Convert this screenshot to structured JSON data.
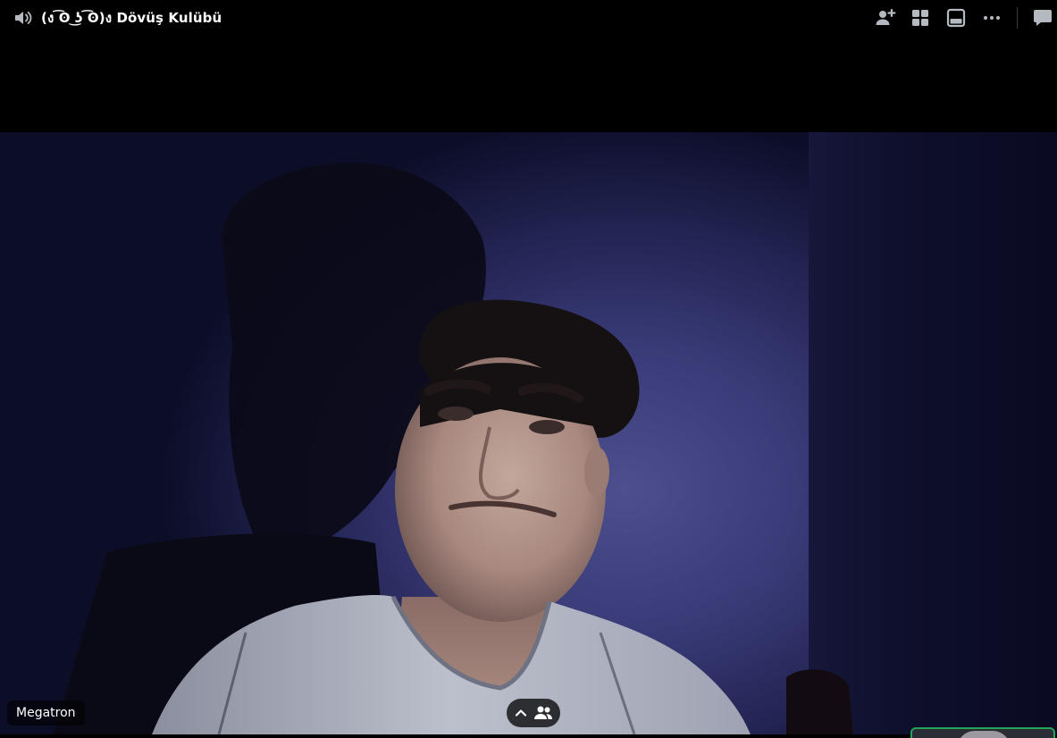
{
  "channel": {
    "name": "(ง ͡ʘ ͜ʖ ͡ʘ)ง Dövüş Kulübü",
    "icon": "speaker-icon"
  },
  "toolbar": {
    "invite_icon": "add-friend-icon",
    "grid_icon": "grid-layout-icon",
    "popout_icon": "popout-icon",
    "more_icon": "more-options-icon",
    "chat_icon": "chat-icon"
  },
  "stream": {
    "participant_name": "Megatron"
  },
  "controls": {
    "toggle_icons": [
      "chevron-up-icon",
      "people-icon"
    ]
  },
  "colors": {
    "background": "#000000",
    "icon": "#b5bac1",
    "speaking_border": "#23a559"
  }
}
